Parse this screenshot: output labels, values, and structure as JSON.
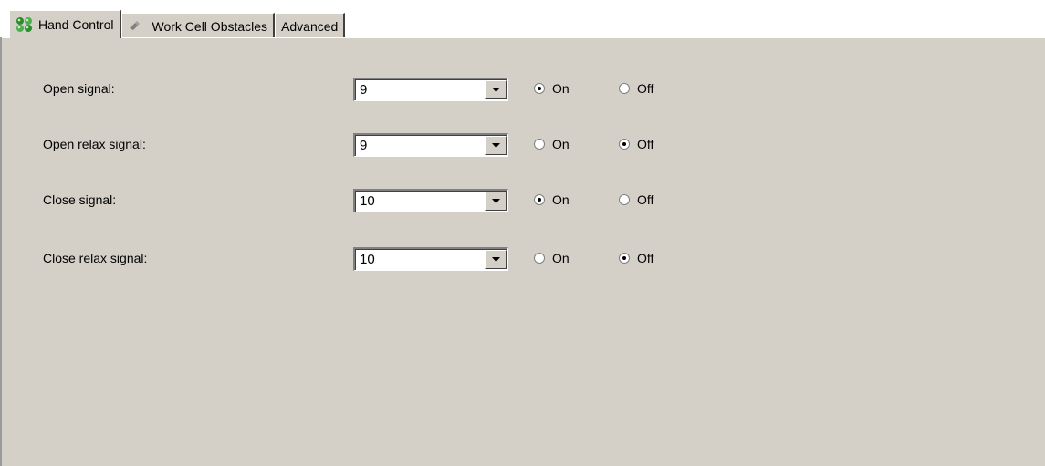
{
  "tabs": [
    {
      "label": "Hand Control",
      "icon": "hand-control-icon",
      "active": true
    },
    {
      "label": "Work Cell Obstacles",
      "icon": "obstacles-icon",
      "active": false
    },
    {
      "label": "Advanced",
      "icon": "",
      "active": false
    }
  ],
  "rows": [
    {
      "label": "Open signal:",
      "value": "9",
      "on_label": "On",
      "off_label": "Off",
      "selected": "on"
    },
    {
      "label": "Open relax signal:",
      "value": "9",
      "on_label": "On",
      "off_label": "Off",
      "selected": "off"
    },
    {
      "label": "Close signal:",
      "value": "10",
      "on_label": "On",
      "off_label": "Off",
      "selected": "on"
    },
    {
      "label": "Close relax signal:",
      "value": "10",
      "on_label": "On",
      "off_label": "Off",
      "selected": "off"
    }
  ],
  "colors": {
    "panel_bg": "#d4d0c8",
    "hand_icon_green": "#3a9a3a"
  }
}
